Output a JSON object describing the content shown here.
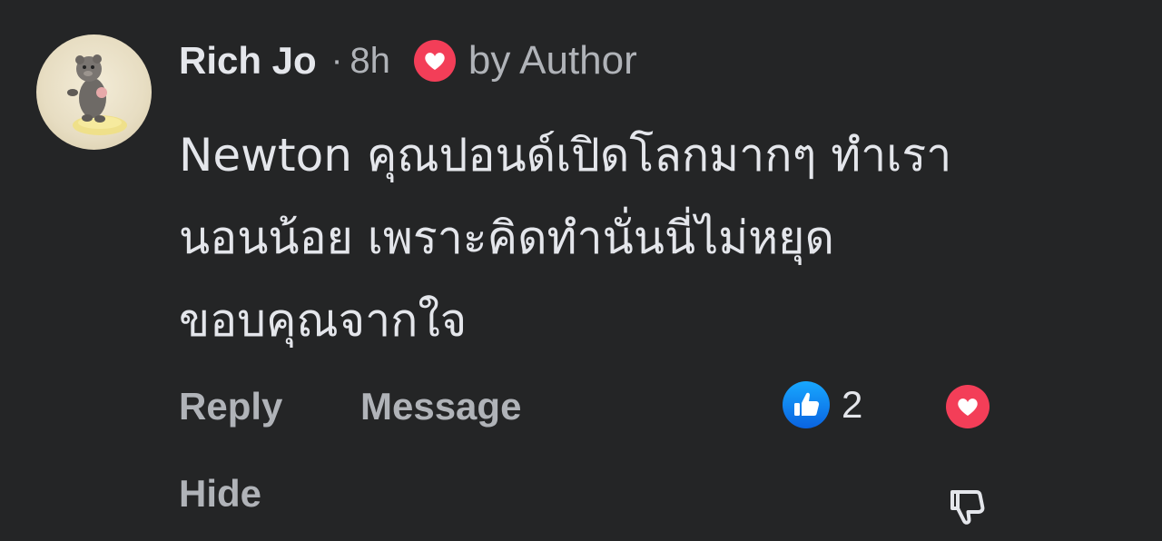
{
  "comment": {
    "author": "Rich Jo",
    "separator": "·",
    "time_ago": "8h",
    "author_reaction_icon": "heart-icon",
    "author_reaction_label": "by Author",
    "text_lines": [
      "Newton คุณปอนด์เปิดโลกมากๆ ทำเรา",
      "นอนน้อย เพราะคิดทำนั่นนี่ไม่หยุด",
      "ขอบคุณจากใจ"
    ]
  },
  "actions": {
    "reply_label": "Reply",
    "message_label": "Message",
    "hide_label": "Hide"
  },
  "reactions": {
    "like_icon": "thumbs-up-icon",
    "like_count": "2",
    "love_icon": "heart-icon",
    "dislike_icon": "thumbs-down-icon"
  },
  "colors": {
    "background": "#242526",
    "primary_text": "#e4e6eb",
    "secondary_text": "#b0b3b8",
    "like_blue": "#1877f2",
    "love_red": "#f33e58"
  }
}
